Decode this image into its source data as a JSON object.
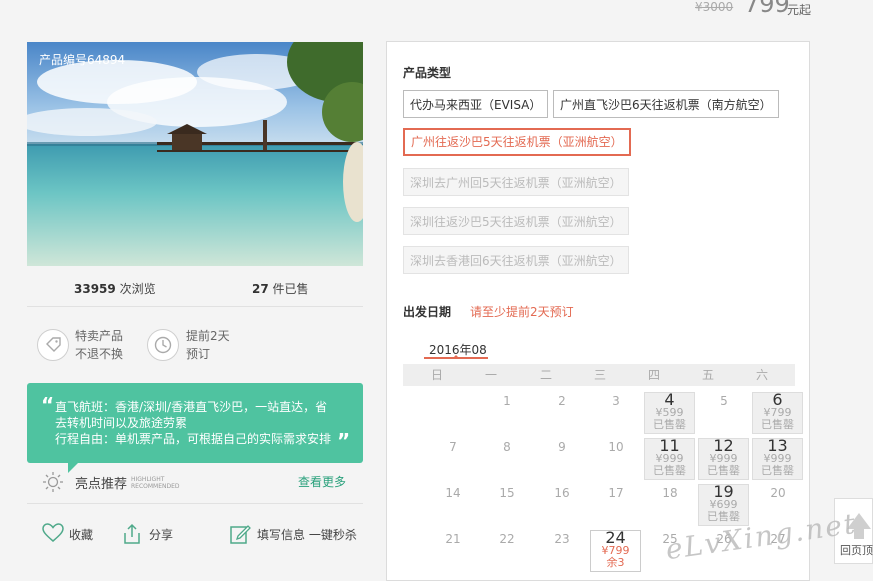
{
  "price": {
    "original": "¥3000",
    "current": "799",
    "unit": "元起"
  },
  "product": {
    "code": "产品编号64894",
    "views_count": "33959",
    "views_label": "次浏览",
    "sold_count": "27",
    "sold_label": "件已售"
  },
  "features": [
    {
      "icon": "tag-icon",
      "line1": "特卖产品",
      "line2": "不退不换"
    },
    {
      "icon": "clock-icon",
      "line1": "提前2天",
      "line2": "预订"
    }
  ],
  "highlight": {
    "lines": [
      "直飞航班：香港/深圳/香港直飞沙巴，一站直达，省",
      "去转机时间以及旅途劳累",
      "行程自由：单机票产品，可根据自己的实际需求安排"
    ],
    "label": "亮点推荐",
    "label_en_1": "HIGHLIGHT",
    "label_en_2": "RECOMMENDED",
    "more": "查看更多"
  },
  "actions": {
    "favorite": "收藏",
    "share": "分享",
    "fill_info": "填写信息 一键秒杀"
  },
  "product_types": {
    "title": "产品类型",
    "options": [
      {
        "label": "代办马来西亚（EVISA）",
        "state": "normal"
      },
      {
        "label": "广州直飞沙巴6天往返机票（南方航空）",
        "state": "normal"
      },
      {
        "label": "广州往返沙巴5天往返机票（亚洲航空）",
        "state": "active"
      },
      {
        "label": "深圳去广州回5天往返机票（亚洲航空）",
        "state": "disabled"
      },
      {
        "label": "深圳往返沙巴5天往返机票（亚洲航空）",
        "state": "disabled"
      },
      {
        "label": "深圳去香港回6天往返机票（亚洲航空）",
        "state": "disabled"
      }
    ]
  },
  "departure": {
    "title": "出发日期",
    "hint": "请至少提前2天预订",
    "month": "2016年08",
    "weekdays": [
      "日",
      "一",
      "二",
      "三",
      "四",
      "五",
      "六"
    ],
    "rows": [
      [
        {
          "day": ""
        },
        {
          "day": "1"
        },
        {
          "day": "2"
        },
        {
          "day": "3"
        },
        {
          "day": "4",
          "price": "¥599",
          "status": "已售罄"
        },
        {
          "day": "5"
        },
        {
          "day": "6",
          "price": "¥799",
          "status": "已售罄"
        }
      ],
      [
        {
          "day": "7"
        },
        {
          "day": "8"
        },
        {
          "day": "9"
        },
        {
          "day": "10"
        },
        {
          "day": "11",
          "price": "¥999",
          "status": "已售罄"
        },
        {
          "day": "12",
          "price": "¥999",
          "status": "已售罄"
        },
        {
          "day": "13",
          "price": "¥999",
          "status": "已售罄"
        }
      ],
      [
        {
          "day": "14"
        },
        {
          "day": "15"
        },
        {
          "day": "16"
        },
        {
          "day": "17"
        },
        {
          "day": "18"
        },
        {
          "day": "19",
          "price": "¥699",
          "status": "已售罄"
        },
        {
          "day": "20"
        }
      ],
      [
        {
          "day": "21"
        },
        {
          "day": "22"
        },
        {
          "day": "23"
        },
        {
          "day": "24",
          "price": "¥799",
          "status": "余3",
          "available": true
        },
        {
          "day": "25"
        },
        {
          "day": "26"
        },
        {
          "day": "27"
        }
      ]
    ]
  },
  "back_to_top": "回页顶",
  "watermark": "eLvXing.net"
}
